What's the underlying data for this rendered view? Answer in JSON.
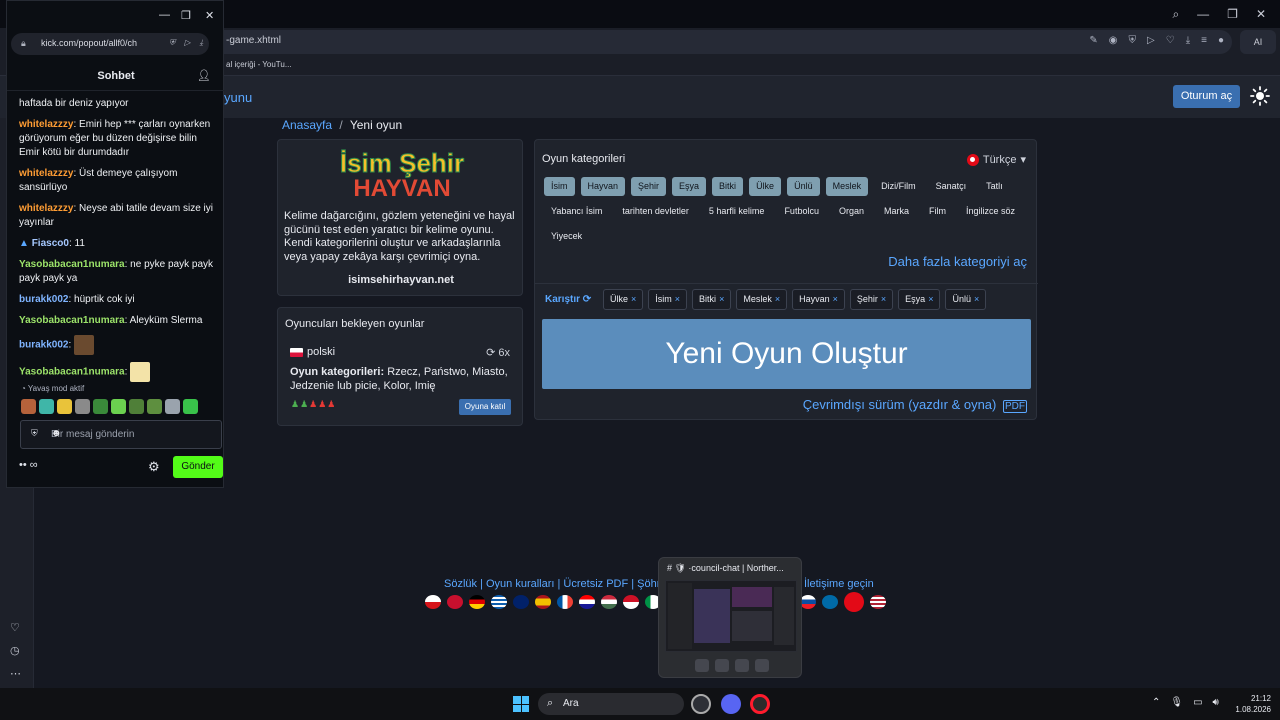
{
  "browser": {
    "address_fragment": "-game.xhtml",
    "bookmark_text": "al içeriği - YouTu...",
    "ai_label": "AI"
  },
  "site": {
    "brand_fragment": "yunu",
    "login_label": "Oturum aç",
    "breadcrumb_home": "Anasayfa",
    "breadcrumb_sep": "/",
    "breadcrumb_current": "Yeni oyun",
    "logo_line1": "İsim Şehir",
    "logo_line2": "HAYVAN",
    "intro_text": "Kelime dağarcığını, gözlem yeteneğini ve hayal gücünü test eden yaratıcı bir kelime oyunu. Kendi kategorilerini oluştur ve arkadaşlarınla veya yapay zekâya karşı çevrimiçi oyna.",
    "intro_site": "isimsehirhayvan.net",
    "waiting_title": "Oyuncuları bekleyen oyunlar",
    "waiting_lang": "polski",
    "waiting_count": "6x",
    "waiting_cats_label": "Oyun kategorileri:",
    "waiting_cats_value": " Rzecz, Państwo, Miasto, Jedzenie lub picie, Kolor, Imię",
    "players_icons": "♟♟♟♟♟",
    "join_label": "Oyuna katıl",
    "cats_title": "Oyun kategorileri",
    "lang_label": "Türkçe",
    "categories": [
      {
        "label": "İsim",
        "on": true
      },
      {
        "label": "Hayvan",
        "on": true
      },
      {
        "label": "Şehir",
        "on": true
      },
      {
        "label": "Eşya",
        "on": true
      },
      {
        "label": "Bitki",
        "on": true
      },
      {
        "label": "Ülke",
        "on": true
      },
      {
        "label": "Ünlü",
        "on": true
      },
      {
        "label": "Meslek",
        "on": true
      },
      {
        "label": "Dizi/Film",
        "on": false
      },
      {
        "label": "Sanatçı",
        "on": false
      },
      {
        "label": "Tatlı",
        "on": false
      },
      {
        "label": "Yabancı İsim",
        "on": false
      },
      {
        "label": "tarihten devletler",
        "on": false
      },
      {
        "label": "5 harfli kelime",
        "on": false
      },
      {
        "label": "Futbolcu",
        "on": false
      },
      {
        "label": "Organ",
        "on": false
      },
      {
        "label": "Marka",
        "on": false
      },
      {
        "label": "Film",
        "on": false
      },
      {
        "label": "İngilizce söz",
        "on": false
      },
      {
        "label": "Yiyecek",
        "on": false
      }
    ],
    "more_cats": "Daha fazla kategoriyi aç",
    "shuffle_label": "Karıştır",
    "selected": [
      "Ülke",
      "İsim",
      "Bitki",
      "Meslek",
      "Hayvan",
      "Şehir",
      "Eşya",
      "Ünlü"
    ],
    "new_game_label": "Yeni Oyun Oluştur",
    "offline_label": "Çevrimdışı sürüm (yazdır & oyna)",
    "footer_links": "Sözlük | Oyun kuralları | Ücretsiz PDF | Şöhre",
    "footer_links_end": "İletişime geçin"
  },
  "kick": {
    "url": "kick.com/popout/allf0/ch",
    "chat_title": "Sohbet",
    "messages": [
      {
        "user": "",
        "cls": "",
        "text": "haftada bir deniz yapıyor"
      },
      {
        "user": "whitelazzzy",
        "cls": "nm-o",
        "text": "Emiri hep *** çarları oynarken görüyorum eğer bu düzen değişirse bilin Emir kötü bir durumdadır"
      },
      {
        "user": "whitelazzzy",
        "cls": "nm-o",
        "text": "Üst demeye çalışıyom sansürlüyo"
      },
      {
        "user": "whitelazzzy",
        "cls": "nm-o",
        "text": "Neyse abi tatile devam size iyi yayınlar"
      },
      {
        "user": "Fiasco0",
        "cls": "nm-c",
        "text": "11"
      },
      {
        "user": "Yasobabacan1numara",
        "cls": "nm-g",
        "text": "ne pyke payk payk payk payk ya"
      },
      {
        "user": "burakk002",
        "cls": "nm-b",
        "text": "hüprtik cok iyi"
      },
      {
        "user": "Yasobabacan1numara",
        "cls": "nm-g",
        "text": "Aleyküm Slerma"
      },
      {
        "user": "burakk002",
        "cls": "nm-b",
        "text": ""
      },
      {
        "user": "Yasobabacan1numara",
        "cls": "nm-g",
        "text": ""
      }
    ],
    "slow_mode": "Yavaş mod aktif",
    "input_placeholder": "Bir mesaj gönderin",
    "send_label": "Gönder",
    "footer_left": "•• ∞"
  },
  "discord_thumb": {
    "title": "# 🛡 ·council-chat | Norther..."
  },
  "taskbar": {
    "search_label": "Ara",
    "time": "21:12",
    "date": "1.08.2026"
  }
}
